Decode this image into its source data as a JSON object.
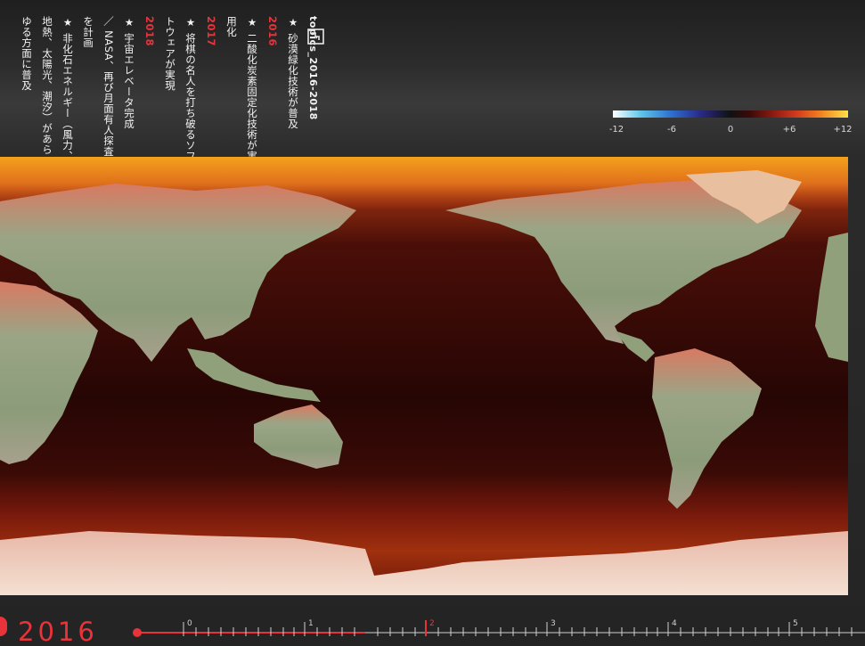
{
  "topics": {
    "heading": "topics_2016-2018",
    "years": [
      {
        "year": "2016",
        "items": [
          "★ 砂漠緑化技術が普及"
        ]
      },
      {
        "year": "2017",
        "items": [
          "★ 二酸化炭素固定化技術が実用化",
          "★ 将棋の名人を打ち破るソフトウェアが実現"
        ]
      },
      {
        "year": "2018",
        "items": [
          "★ 宇宙エレベータ完成",
          "／ NASA、再び月面有人探査を計画",
          "★ 非化石エネルギー（風力、地熱、太陽光、潮汐）があらゆる方面に普及"
        ]
      }
    ],
    "icon": "book-icon"
  },
  "legend": {
    "ticks": [
      "-12",
      "-6",
      "0",
      "+6",
      "+12"
    ],
    "colors": {
      "cold_max": "#ffffff",
      "cold": "#2c6fd0",
      "neutral": "#111111",
      "warm": "#d23a1e",
      "hot_max": "#ffe04a"
    }
  },
  "map": {
    "projection": "Pacific-centered world map",
    "colors": {
      "ocean": "#2a0806",
      "ocean_warm": "#7a1a0c",
      "land": "#8a9a78",
      "arctic": "#f0a020",
      "antarctic": "#f0d8c8"
    }
  },
  "timeline": {
    "year": "2016",
    "tick_labels": [
      "0",
      "1",
      "2",
      "3",
      "4",
      "5"
    ],
    "accent": "#e8333a"
  }
}
